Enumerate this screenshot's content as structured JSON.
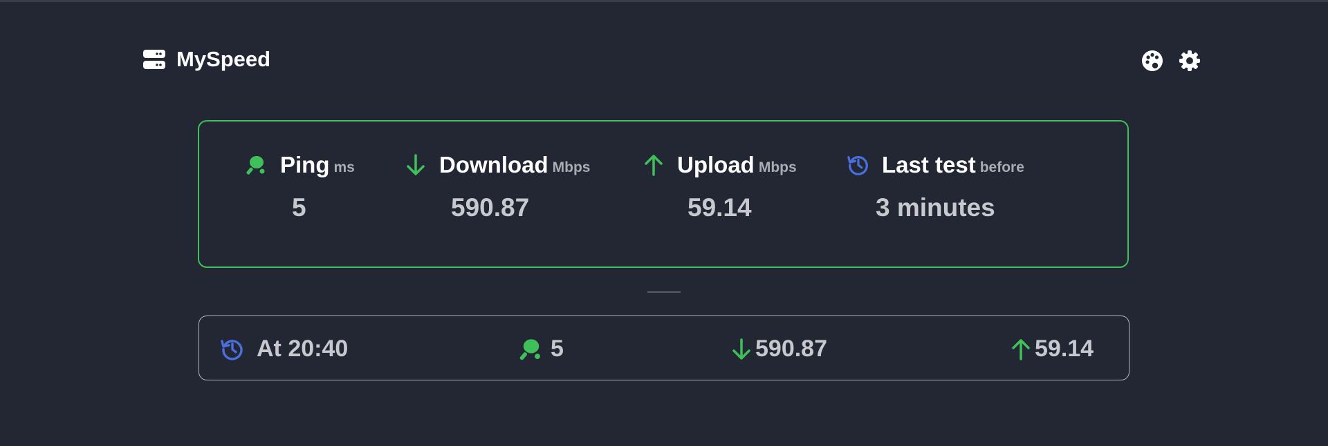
{
  "app": {
    "title": "MySpeed"
  },
  "header": {
    "actions": [
      {
        "icon": "palette-icon"
      },
      {
        "icon": "gear-icon"
      }
    ]
  },
  "colors": {
    "background": "#232733",
    "accent_green": "#3fc05a",
    "accent_blue": "#4a6fdc",
    "text_primary": "#ffffff",
    "text_value": "#c7c9ce",
    "text_unit": "#a9acb3"
  },
  "stats": {
    "ping": {
      "label": "Ping",
      "unit": "ms",
      "value": "5",
      "icon": "ping-pong-icon"
    },
    "download": {
      "label": "Download",
      "unit": "Mbps",
      "value": "590.87",
      "icon": "arrow-down-icon"
    },
    "upload": {
      "label": "Upload",
      "unit": "Mbps",
      "value": "59.14",
      "icon": "arrow-up-icon"
    },
    "last_test": {
      "label": "Last test",
      "unit": "before",
      "value": "3 minutes",
      "icon": "history-icon"
    }
  },
  "history": [
    {
      "time": "At 20:40",
      "ping": "5",
      "download": "590.87",
      "upload": "59.14"
    }
  ]
}
